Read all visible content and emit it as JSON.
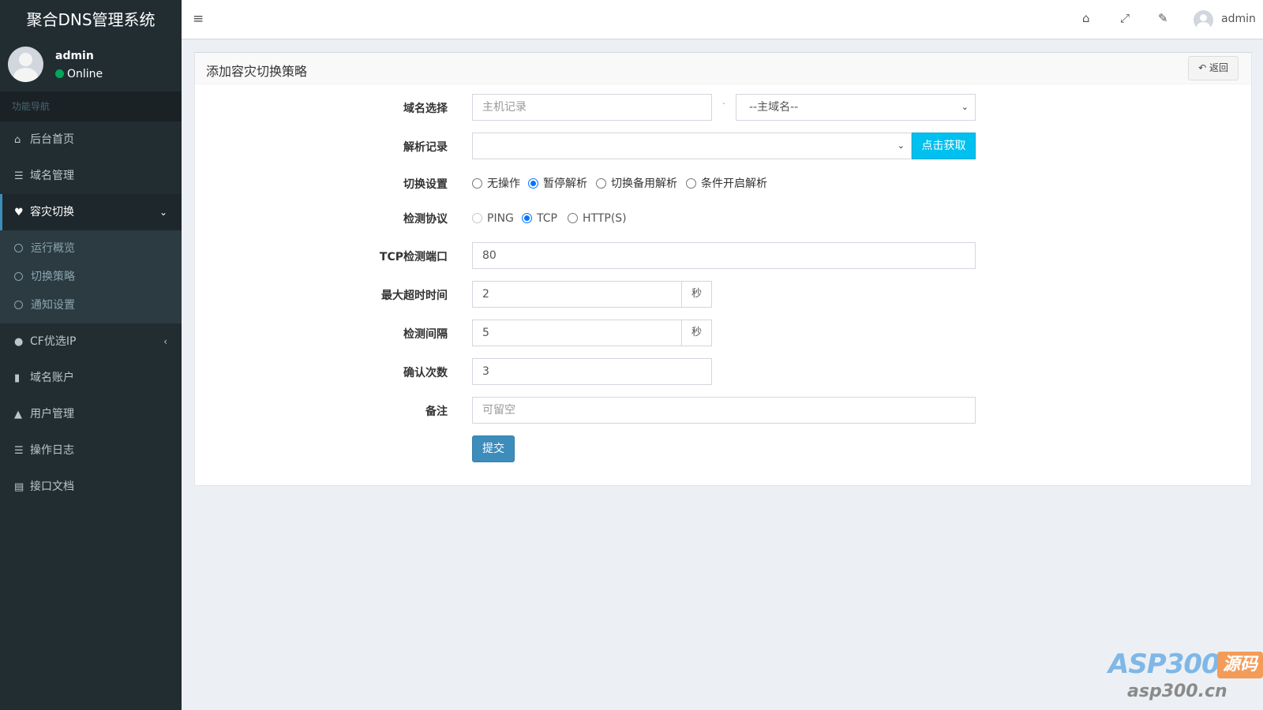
{
  "app": {
    "title": "聚合DNS管理系统"
  },
  "user": {
    "name": "admin",
    "status": "Online"
  },
  "sidebar": {
    "header": "功能导航",
    "items": [
      {
        "label": "后台首页",
        "icon": "home-icon"
      },
      {
        "label": "域名管理",
        "icon": "list-icon"
      },
      {
        "label": "容灾切换",
        "icon": "heartbeat-icon"
      },
      {
        "label": "CF优选IP",
        "icon": "globe-icon"
      },
      {
        "label": "域名账户",
        "icon": "lock-icon"
      },
      {
        "label": "用户管理",
        "icon": "user-icon"
      },
      {
        "label": "操作日志",
        "icon": "list-icon"
      },
      {
        "label": "接口文档",
        "icon": "book-icon"
      }
    ],
    "submenu": [
      {
        "label": "运行概览"
      },
      {
        "label": "切换策略"
      },
      {
        "label": "通知设置"
      }
    ]
  },
  "navbar": {
    "username": "admin"
  },
  "box": {
    "title": "添加容灾切换策略",
    "back_label": "返回"
  },
  "form": {
    "domain": {
      "label": "域名选择",
      "host_placeholder": "主机记录",
      "separator": ".",
      "main_domain": "--主域名--"
    },
    "record": {
      "label": "解析记录",
      "value": "",
      "fetch_button": "点击获取"
    },
    "switch": {
      "label": "切换设置",
      "options": [
        "无操作",
        "暂停解析",
        "切换备用解析",
        "条件开启解析"
      ],
      "selected": "暂停解析"
    },
    "protocol": {
      "label": "检测协议",
      "options": [
        "PING",
        "TCP",
        "HTTP(S)"
      ],
      "selected": "TCP"
    },
    "tcp_port": {
      "label": "TCP检测端口",
      "value": "80"
    },
    "timeout": {
      "label": "最大超时时间",
      "value": "2",
      "unit": "秒"
    },
    "interval": {
      "label": "检测间隔",
      "value": "5",
      "unit": "秒"
    },
    "confirm": {
      "label": "确认次数",
      "value": "3"
    },
    "remark": {
      "label": "备注",
      "placeholder": "可留空"
    },
    "submit_label": "提交"
  },
  "watermark": {
    "brand": "ASP300",
    "badge": "源码",
    "url": "asp300.cn"
  },
  "colors": {
    "sidebar_bg": "#222d32",
    "accent": "#3c8dbc",
    "info": "#00c0ef",
    "online": "#00a65a"
  }
}
